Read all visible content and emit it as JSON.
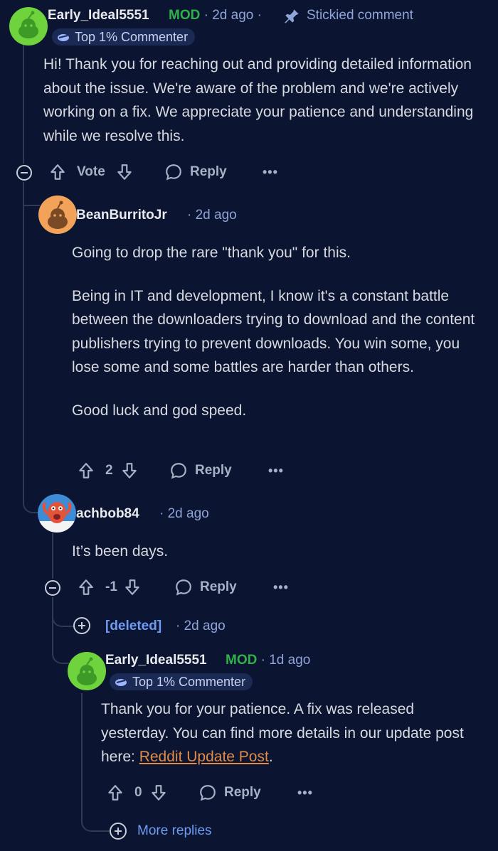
{
  "comments": [
    {
      "author": "Early_Ideal5551",
      "mod_tag": "MOD",
      "time": "2d ago",
      "sticky_label": "Stickied comment",
      "flair": "Top 1% Commenter",
      "body": "Hi! Thank you for reaching out and providing detailed information about the issue. We're aware of the problem and we're actively working on a fix. We appreciate your patience and understanding while we resolve this.",
      "vote_label": "Vote",
      "reply_label": "Reply"
    },
    {
      "author": "BeanBurritoJr",
      "time": "2d ago",
      "body_paragraphs": [
        "Going to drop the rare \"thank you\" for this.",
        "Being in IT and development, I know it's a constant battle between the downloaders trying to download and the content publishers trying to prevent downloads. You win some, you lose some and some battles are harder than others.",
        "Good luck and god speed."
      ],
      "score": "2",
      "reply_label": "Reply"
    },
    {
      "author": "achbob84",
      "time": "2d ago",
      "body": "It’s been days.",
      "score": "-1",
      "reply_label": "Reply"
    },
    {
      "author": "[deleted]",
      "time": "2d ago"
    },
    {
      "author": "Early_Ideal5551",
      "mod_tag": "MOD",
      "time": "1d ago",
      "flair": "Top 1% Commenter",
      "body_prefix": "Thank you for your patience. A fix was released yesterday. You can find more details in our update post here: ",
      "link_text": "Reddit Update Post",
      "body_suffix": ".",
      "score": "0",
      "reply_label": "Reply"
    }
  ],
  "more_replies_label": "More replies",
  "colors": {
    "background": "#0b1430",
    "mod_green": "#2fb14a",
    "meta_blue": "#8fa4d8",
    "link_orange": "#e08b4a"
  }
}
